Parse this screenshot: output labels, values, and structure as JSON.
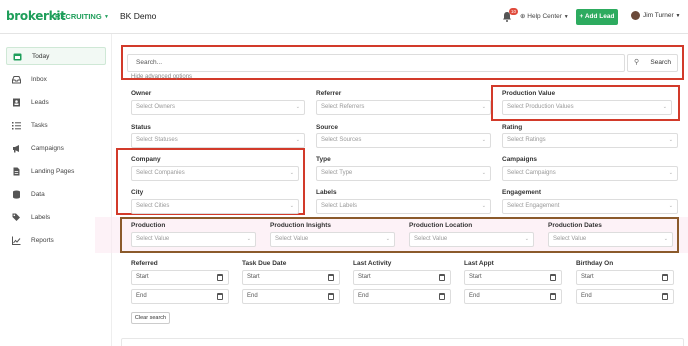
{
  "header": {
    "brand": "brokerkit",
    "product": "RECRUITING",
    "page_title": "BK Demo",
    "notification_count": "10",
    "help_label": "Help Center",
    "add_lead_label": "+ Add Lead",
    "user_name": "Jim Turner"
  },
  "sidebar": {
    "items": [
      {
        "label": "Today",
        "icon": "calendar-icon"
      },
      {
        "label": "Inbox",
        "icon": "inbox-icon"
      },
      {
        "label": "Leads",
        "icon": "contact-card-icon"
      },
      {
        "label": "Tasks",
        "icon": "list-icon"
      },
      {
        "label": "Campaigns",
        "icon": "megaphone-icon"
      },
      {
        "label": "Landing Pages",
        "icon": "document-icon"
      },
      {
        "label": "Data",
        "icon": "database-icon"
      },
      {
        "label": "Labels",
        "icon": "tags-icon"
      },
      {
        "label": "Reports",
        "icon": "chart-icon"
      }
    ]
  },
  "search": {
    "placeholder": "Search...",
    "button_label": "Search",
    "hide_advanced": "Hide advanced options"
  },
  "filters": {
    "owner": {
      "label": "Owner",
      "placeholder": "Select Owners"
    },
    "referrer": {
      "label": "Referrer",
      "placeholder": "Select Referrers"
    },
    "production_value": {
      "label": "Production Value",
      "placeholder": "Select Production Values"
    },
    "status": {
      "label": "Status",
      "placeholder": "Select Statuses"
    },
    "source": {
      "label": "Source",
      "placeholder": "Select Sources"
    },
    "rating": {
      "label": "Rating",
      "placeholder": "Select Ratings"
    },
    "company": {
      "label": "Company",
      "placeholder": "Select Companies"
    },
    "type": {
      "label": "Type",
      "placeholder": "Select Type"
    },
    "campaigns": {
      "label": "Campaigns",
      "placeholder": "Select Campaigns"
    },
    "city": {
      "label": "City",
      "placeholder": "Select Cities"
    },
    "labels": {
      "label": "Labels",
      "placeholder": "Select Labels"
    },
    "engagement": {
      "label": "Engagement",
      "placeholder": "Select Engagement"
    },
    "production": {
      "label": "Production",
      "placeholder": "Select Value"
    },
    "production_insights": {
      "label": "Production Insights",
      "placeholder": "Select Value"
    },
    "production_location": {
      "label": "Production Location",
      "placeholder": "Select Value"
    },
    "production_dates": {
      "label": "Production Dates",
      "placeholder": "Select Value"
    }
  },
  "dates": {
    "start_label": "Start",
    "end_label": "End",
    "columns": [
      "Referred",
      "Task Due Date",
      "Last Activity",
      "Last Appt",
      "Birthday On"
    ]
  },
  "clear_search_label": "Clear search",
  "colors": {
    "brand": "#1e9e5a",
    "highlight_red": "#d23a2a",
    "highlight_brown": "#8b5a2b"
  }
}
